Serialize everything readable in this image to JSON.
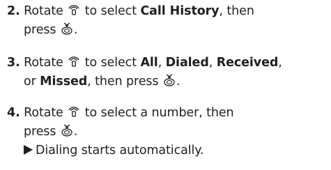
{
  "steps": [
    {
      "number": "2.",
      "rotate": "Rotate",
      "select": "to select",
      "target1": "Call History",
      "then": ", then",
      "press": "press",
      "end": "."
    },
    {
      "number": "3.",
      "rotate": "Rotate",
      "select": "to select",
      "opt_all": "All",
      "sep1": ",",
      "opt_dialed": "Dialed",
      "sep2": ",",
      "opt_received": "Received",
      "sep3": ",",
      "or": "or",
      "opt_missed": "Missed",
      "then_press": ", then press",
      "end": "."
    },
    {
      "number": "4.",
      "rotate": "Rotate",
      "select_number": "to select a number, then",
      "press": "press",
      "end": ".",
      "result": "Dialing starts automatically."
    }
  ],
  "icons": {
    "rotate": "interface-dial-rotate-icon",
    "press": "interface-dial-press-icon",
    "result": "result-triangle-icon"
  }
}
